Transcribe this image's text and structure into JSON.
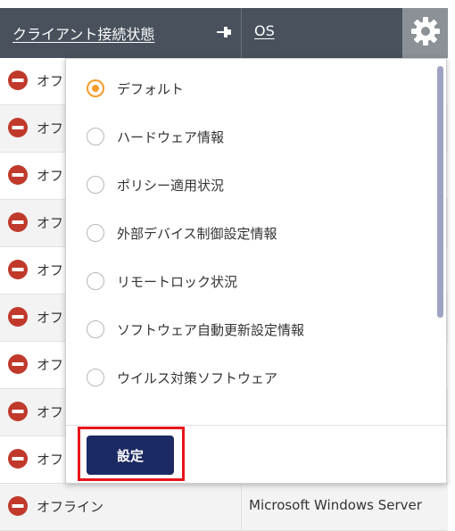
{
  "header": {
    "client_status_title": "クライアント接続状態",
    "os_title": "OS",
    "pin_icon": "pin-icon",
    "gear_icon": "gear-icon"
  },
  "rows": [
    {
      "status": "オフラ",
      "os": ""
    },
    {
      "status": "オフラ",
      "os": ""
    },
    {
      "status": "オフラ",
      "os": ""
    },
    {
      "status": "オフラ",
      "os": ""
    },
    {
      "status": "オフラ",
      "os": ""
    },
    {
      "status": "オフラ",
      "os": ""
    },
    {
      "status": "オフラ",
      "os": ""
    },
    {
      "status": "オフラ",
      "os": ""
    },
    {
      "status": "オフラ",
      "os": ""
    },
    {
      "status": "オフライン",
      "os": "Microsoft Windows Server"
    }
  ],
  "status_icon": "offline-no-entry-icon",
  "colors": {
    "header_bg": "#48515c",
    "gear_bg": "#8b9197",
    "offline_red": "#c0392b",
    "radio_selected": "#f39c2b",
    "button_bg": "#1c2a63",
    "highlight_red": "#e8141b"
  },
  "dropdown": {
    "options": [
      {
        "label": "デフォルト",
        "selected": true
      },
      {
        "label": "ハードウェア情報",
        "selected": false
      },
      {
        "label": "ポリシー適用状況",
        "selected": false
      },
      {
        "label": "外部デバイス制御設定情報",
        "selected": false
      },
      {
        "label": "リモートロック状況",
        "selected": false
      },
      {
        "label": "ソフトウェア自動更新設定情報",
        "selected": false
      },
      {
        "label": "ウイルス対策ソフトウェア",
        "selected": false
      }
    ],
    "submit_label": "設定"
  }
}
